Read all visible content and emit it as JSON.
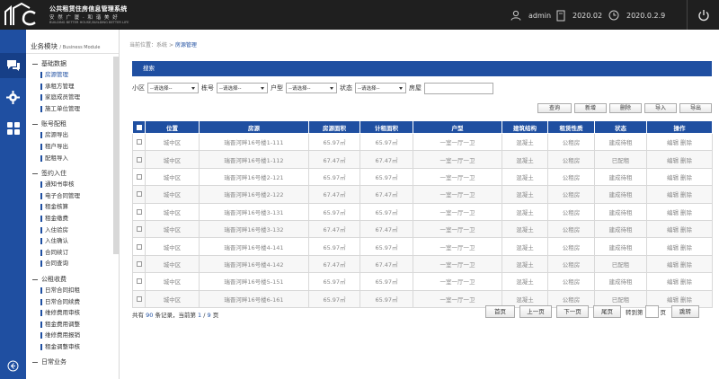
{
  "header": {
    "title": "公共租赁住房信息管理系统",
    "slogan": "安 然 广 厦 · 和 谐 美 好",
    "slogan_en": "BUILDING BETTER HOUSE,BUILDING BETTER LIFE",
    "user": "admin",
    "period": "2020.02",
    "date": "2020.0.2.9"
  },
  "sidebar": {
    "title": "业务模块",
    "title_en": "/ Business Module",
    "groups": [
      {
        "title": "基础数据",
        "items": [
          "房源管理",
          "承租方管理",
          "家庭成员管理",
          "施工单位管理"
        ]
      },
      {
        "title": "账号配租",
        "items": [
          "房源导出",
          "租户导出",
          "配租导入"
        ]
      },
      {
        "title": "签约入住",
        "items": [
          "通知书审核",
          "电子合同管理",
          "租金核算",
          "租金缴费",
          "入住验房",
          "入住确认",
          "合同续订",
          "合同查询"
        ]
      },
      {
        "title": "公租收费",
        "items": [
          "日常合同扣租",
          "日常合同续费",
          "维修费用审核",
          "租金费用调整",
          "维修费用报销",
          "租金调整审核"
        ]
      },
      {
        "title": "日常业务",
        "items": []
      }
    ]
  },
  "breadcrumb": {
    "prefix": "当前位置：",
    "path": "系统",
    "sep": ">",
    "current": "房源管理"
  },
  "search": {
    "panel_title": "搜索",
    "fields": [
      {
        "label": "小区",
        "value": "--请选择--"
      },
      {
        "label": "栋号",
        "value": "--请选择--"
      },
      {
        "label": "户型",
        "value": "--请选择--"
      },
      {
        "label": "状态",
        "value": "--请选择--"
      }
    ],
    "room_label": "房屋",
    "room_value": ""
  },
  "actions": {
    "query": "查询",
    "add": "新增",
    "delete": "删除",
    "import": "导入",
    "export": "导出"
  },
  "table": {
    "headers": [
      "位置",
      "房源",
      "房源面积",
      "计租面积",
      "户型",
      "建筑结构",
      "租赁性质",
      "状态",
      "操作"
    ],
    "rows": [
      [
        "城中区",
        "瑞晋河畔16号楼1-111",
        "65.97㎡",
        "65.97㎡",
        "一室一厅一卫",
        "混凝土",
        "公租房",
        "建成待租"
      ],
      [
        "城中区",
        "瑞晋河畔16号楼1-112",
        "67.47㎡",
        "67.47㎡",
        "一室一厅一卫",
        "混凝土",
        "公租房",
        "已配租"
      ],
      [
        "城中区",
        "瑞晋河畔16号楼2-121",
        "65.97㎡",
        "65.97㎡",
        "一室一厅一卫",
        "混凝土",
        "公租房",
        "建成待租"
      ],
      [
        "城中区",
        "瑞晋河畔16号楼2-122",
        "67.47㎡",
        "67.47㎡",
        "一室一厅一卫",
        "混凝土",
        "公租房",
        "建成待租"
      ],
      [
        "城中区",
        "瑞晋河畔16号楼3-131",
        "65.97㎡",
        "65.97㎡",
        "一室一厅一卫",
        "混凝土",
        "公租房",
        "建成待租"
      ],
      [
        "城中区",
        "瑞晋河畔16号楼3-132",
        "67.47㎡",
        "67.47㎡",
        "一室一厅一卫",
        "混凝土",
        "公租房",
        "建成待租"
      ],
      [
        "城中区",
        "瑞晋河畔16号楼4-141",
        "65.97㎡",
        "65.97㎡",
        "一室一厅一卫",
        "混凝土",
        "公租房",
        "建成待租"
      ],
      [
        "城中区",
        "瑞晋河畔16号楼4-142",
        "67.47㎡",
        "67.47㎡",
        "一室一厅一卫",
        "混凝土",
        "公租房",
        "已配租"
      ],
      [
        "城中区",
        "瑞晋河畔16号楼5-151",
        "65.97㎡",
        "65.97㎡",
        "一室一厅一卫",
        "混凝土",
        "公租房",
        "建成待租"
      ],
      [
        "城中区",
        "瑞晋河畔16号楼6-161",
        "65.97㎡",
        "65.97㎡",
        "一室一厅一卫",
        "混凝土",
        "公租房",
        "已配租"
      ]
    ],
    "op_edit": "编辑",
    "op_delete": "删除"
  },
  "footer": {
    "total_prefix": "共有",
    "total": "90",
    "total_mid": "条记录，当前第",
    "page": "1",
    "page_sep": "/",
    "pages": "9",
    "page_suffix": "页"
  },
  "pager": {
    "first": "首页",
    "prev": "上一页",
    "next": "下一页",
    "last": "尾页",
    "goto": "转到第",
    "page_unit": "页",
    "jump": "跳转"
  },
  "colors": {
    "accent": "#1f4fa1",
    "topbar": "#1f1f1f"
  }
}
